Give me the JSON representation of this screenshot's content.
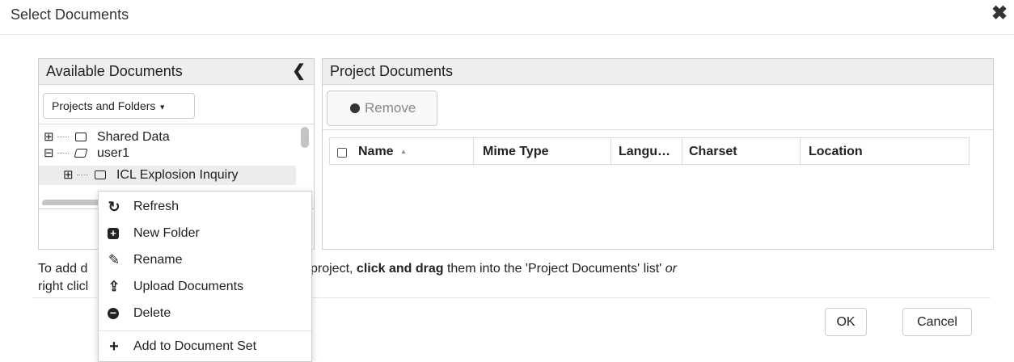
{
  "dialog": {
    "title": "Select Documents",
    "close_glyph": "✖"
  },
  "available": {
    "header": "Available Documents",
    "collapse_glyph": "❮",
    "dropdown_label": "Projects and Folders",
    "tree": [
      {
        "expander": "⊞",
        "label": "Shared Data"
      },
      {
        "expander": "⊟",
        "label": "user1"
      },
      {
        "expander": "⊞",
        "label": "ICL Explosion Inquiry"
      }
    ]
  },
  "project": {
    "header": "Project Documents",
    "remove_label": "Remove",
    "columns": [
      "Name",
      "Mime Type",
      "Langu…",
      "Charset",
      "Location"
    ],
    "sort_indicator": "▲"
  },
  "context_menu": {
    "items": [
      {
        "icon": "refresh-icon",
        "glyph": "↻",
        "label": "Refresh"
      },
      {
        "icon": "plus-square-icon",
        "glyph": "⊞",
        "label": "New Folder"
      },
      {
        "icon": "edit-icon",
        "glyph": "✎",
        "label": "Rename"
      },
      {
        "icon": "upload-icon",
        "glyph": "⇪",
        "label": "Upload Documents"
      },
      {
        "icon": "minus-circle-icon",
        "glyph": "⊖",
        "label": "Delete"
      },
      {
        "icon": "plus-icon",
        "glyph": "+",
        "label": "Add to Document Set"
      }
    ]
  },
  "instructions": {
    "line1_a": "To add d",
    "line1_b": "project, ",
    "line1_bold": "click and drag",
    "line1_c": " them into the 'Project Documents' list' ",
    "line1_italic": "or",
    "line2_a": "right clicl"
  },
  "footer": {
    "ok_label": "OK",
    "cancel_label": "Cancel"
  },
  "colors": {
    "panel_header_bg": "#eeeeee",
    "border": "#cfcfcf",
    "selected_row": "#ececec"
  }
}
